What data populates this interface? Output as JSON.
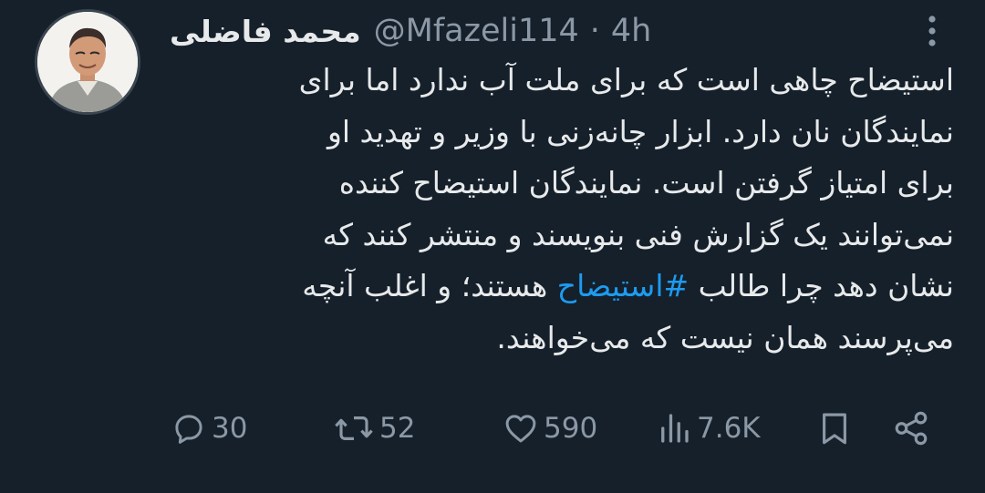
{
  "author": {
    "display_name": "محمد فاضلی",
    "handle": "@Mfazeli114",
    "separator": "·",
    "time": "4h"
  },
  "tweet": {
    "lines": [
      "استیضاح چاهی است که برای ملت آب ندارد اما برای",
      "نمایندگان نان دارد. ابزار چانه‌زنی با وزیر و تهدید او",
      "برای امتیاز گرفتن است. نمایندگان استیضاح کننده",
      "نمی‌توانند یک گزارش فنی بنویسند و منتشر کنند که"
    ],
    "line5_before": "نشان دهد چرا طالب ",
    "hashtag": "#استیضاح",
    "line5_after": " هستند؛ و اغلب آنچه",
    "line6": "می‌پرسند همان نیست که می‌خواهند."
  },
  "actions": {
    "replies": "30",
    "retweets": "52",
    "likes": "590",
    "views": "7.6K"
  },
  "colors": {
    "background": "#15202b",
    "text": "#e7e9ea",
    "secondary": "#8b98a5",
    "link": "#1d9bf0"
  },
  "icons": [
    "avatar",
    "more-icon",
    "reply-icon",
    "retweet-icon",
    "like-icon",
    "views-icon",
    "bookmark-icon",
    "share-icon"
  ]
}
